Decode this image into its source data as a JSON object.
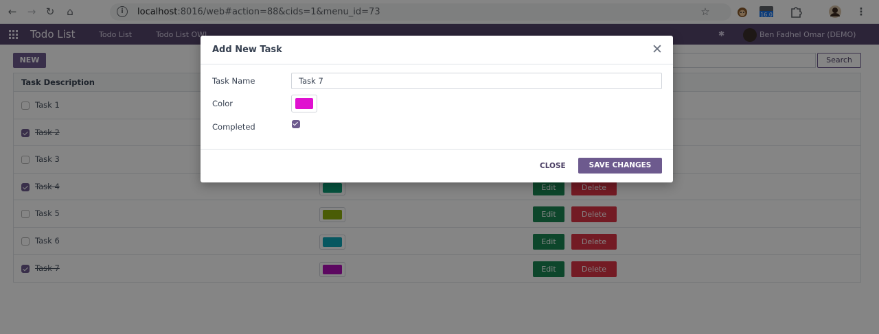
{
  "browser": {
    "url_host": "localhost",
    "url_rest": ":8016/web#action=88&cids=1&menu_id=73",
    "ext_badge": "16.0"
  },
  "navbar": {
    "brand": "Todo List",
    "menu": [
      "Todo List",
      "Todo List OWL"
    ],
    "user": "Ben Fadhel Omar (DEMO)"
  },
  "toolbar": {
    "new_label": "NEW",
    "search_label": "Search"
  },
  "table": {
    "header": "Task Description",
    "rows": [
      {
        "name": "Task 1",
        "completed": false,
        "color": "#ffffff"
      },
      {
        "name": "Task 2",
        "completed": true,
        "color": "#ffffff"
      },
      {
        "name": "Task 3",
        "completed": false,
        "color": "#ffffff"
      },
      {
        "name": "Task 4",
        "completed": true,
        "color": "#0d9e78"
      },
      {
        "name": "Task 5",
        "completed": false,
        "color": "#8fb00c"
      },
      {
        "name": "Task 6",
        "completed": false,
        "color": "#0fa8b8"
      },
      {
        "name": "Task 7",
        "completed": true,
        "color": "#b00fb8"
      }
    ],
    "edit_label": "Edit",
    "delete_label": "Delete"
  },
  "modal": {
    "title": "Add New Task",
    "task_name_label": "Task Name",
    "task_name_value": "Task 7",
    "color_label": "Color",
    "color_value": "#e010d0",
    "completed_label": "Completed",
    "completed": true,
    "close_label": "CLOSE",
    "save_label": "SAVE CHANGES"
  }
}
